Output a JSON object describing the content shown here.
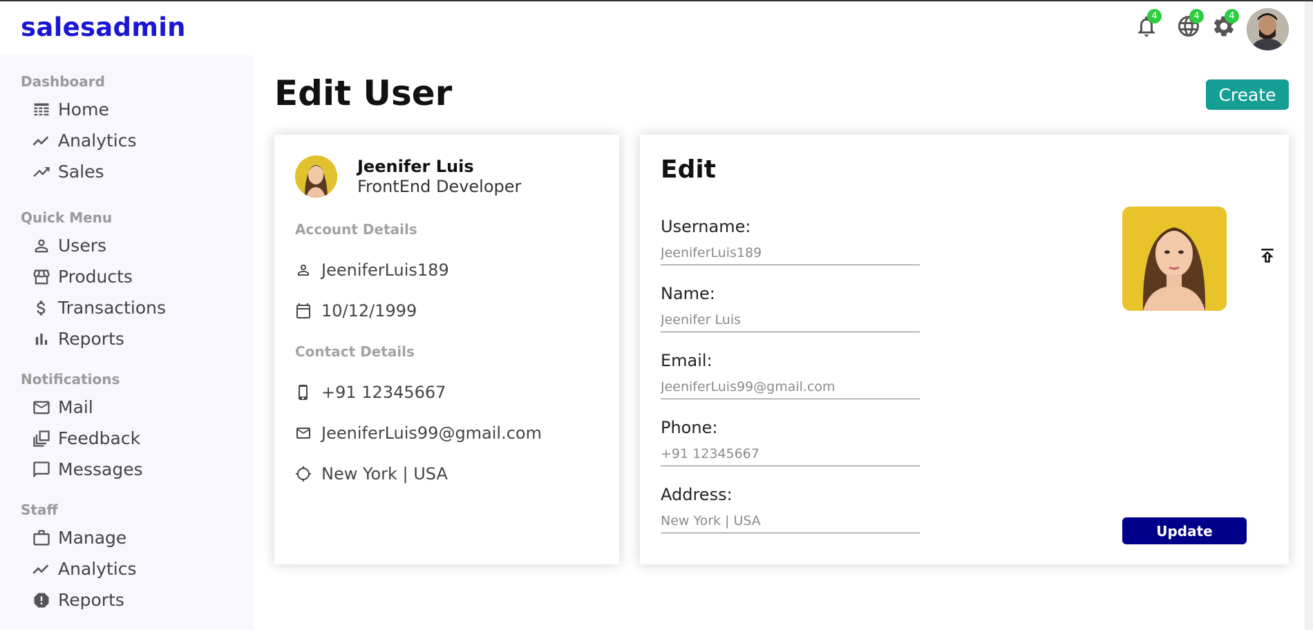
{
  "app": {
    "logo": "salesadmin"
  },
  "topbar": {
    "notifications_badge": "4",
    "language_badge": "4",
    "settings_badge": "4"
  },
  "sidebar": {
    "groups": [
      {
        "title": "Dashboard",
        "items": [
          {
            "label": "Home",
            "icon": "dashboard-icon"
          },
          {
            "label": "Analytics",
            "icon": "timeline-icon"
          },
          {
            "label": "Sales",
            "icon": "trending-up-icon"
          }
        ]
      },
      {
        "title": "Quick Menu",
        "items": [
          {
            "label": "Users",
            "icon": "person-icon"
          },
          {
            "label": "Products",
            "icon": "storefront-icon"
          },
          {
            "label": "Transactions",
            "icon": "dollar-icon"
          },
          {
            "label": "Reports",
            "icon": "bar-chart-icon"
          }
        ]
      },
      {
        "title": "Notifications",
        "items": [
          {
            "label": "Mail",
            "icon": "mail-icon"
          },
          {
            "label": "Feedback",
            "icon": "dynamic-feed-icon"
          },
          {
            "label": "Messages",
            "icon": "chat-bubble-icon"
          }
        ]
      },
      {
        "title": "Staff",
        "items": [
          {
            "label": "Manage",
            "icon": "work-icon"
          },
          {
            "label": "Analytics",
            "icon": "timeline-icon"
          },
          {
            "label": "Reports",
            "icon": "report-icon"
          }
        ]
      }
    ]
  },
  "main": {
    "title": "Edit User",
    "create_label": "Create"
  },
  "user_show": {
    "name": "Jeenifer Luis",
    "job": "FrontEnd Developer",
    "account_title": "Account Details",
    "username": "JeeniferLuis189",
    "birthdate": "10/12/1999",
    "contact_title": "Contact Details",
    "phone": "+91 12345667",
    "email": "JeeniferLuis99@gmail.com",
    "address": "New York | USA"
  },
  "user_edit": {
    "title": "Edit",
    "fields": {
      "username": {
        "label": "Username:",
        "placeholder": "JeeniferLuis189"
      },
      "name": {
        "label": "Name:",
        "placeholder": "Jeenifer Luis"
      },
      "email": {
        "label": "Email:",
        "placeholder": "JeeniferLuis99@gmail.com"
      },
      "phone": {
        "label": "Phone:",
        "placeholder": "+91 12345667"
      },
      "address": {
        "label": "Address:",
        "placeholder": "New York | USA"
      }
    },
    "update_label": "Update"
  },
  "colors": {
    "logo": "#1a16d4",
    "create_button": "#159e94",
    "update_button": "#00008b",
    "badge": "#2ecc40",
    "sidebar_bg": "#f7f7fd"
  }
}
